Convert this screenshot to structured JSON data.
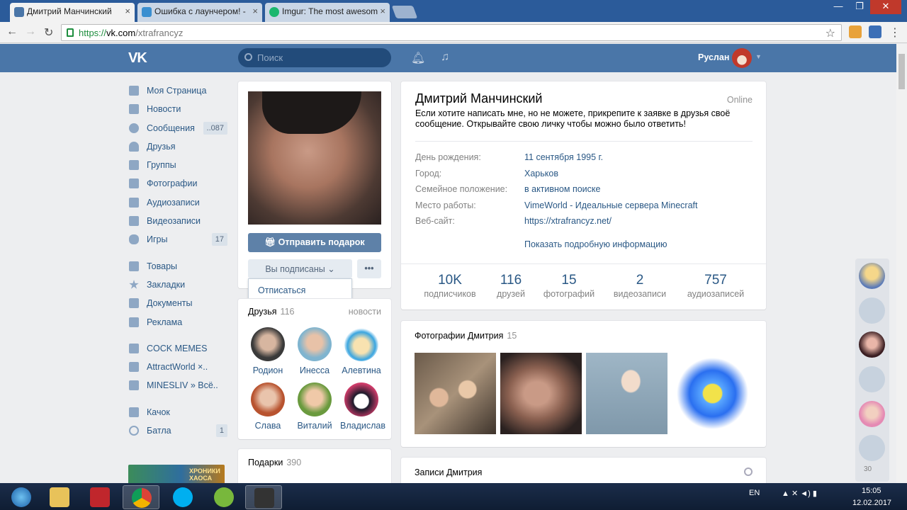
{
  "browser": {
    "tabs": [
      {
        "title": "Дмитрий Манчинский",
        "close": "×"
      },
      {
        "title": "Ошибка с лаунчером! - ",
        "close": "×"
      },
      {
        "title": "Imgur: The most awesom",
        "close": "×"
      }
    ],
    "url_scheme": "https://",
    "url_host": "vk.com",
    "url_path": "/xtrafrancyz",
    "window_controls": {
      "minimize": "—",
      "maximize": "❐",
      "close": "✕"
    }
  },
  "header": {
    "logo": "VK",
    "search_placeholder": "Поиск",
    "user_name": "Руслан"
  },
  "sidebar": {
    "items": [
      {
        "label": "Моя Страница",
        "icon": "home-icon"
      },
      {
        "label": "Новости",
        "icon": "news-icon"
      },
      {
        "label": "Сообщения",
        "icon": "messages-icon",
        "count": "..087"
      },
      {
        "label": "Друзья",
        "icon": "friends-icon"
      },
      {
        "label": "Группы",
        "icon": "groups-icon"
      },
      {
        "label": "Фотографии",
        "icon": "camera-icon"
      },
      {
        "label": "Аудиозаписи",
        "icon": "music-icon"
      },
      {
        "label": "Видеозаписи",
        "icon": "video-icon"
      },
      {
        "label": "Игры",
        "icon": "gamepad-icon",
        "count": "17"
      }
    ],
    "items2": [
      {
        "label": "Товары",
        "icon": "bag-icon"
      },
      {
        "label": "Закладки",
        "icon": "star-icon"
      },
      {
        "label": "Документы",
        "icon": "document-icon"
      },
      {
        "label": "Реклама",
        "icon": "megaphone-icon"
      }
    ],
    "groups": [
      {
        "label": "COCK MEMES"
      },
      {
        "label": "AttractWorld ×.."
      },
      {
        "label": "MINESLIV » Всё.."
      }
    ],
    "apps": [
      {
        "label": "Качок",
        "icon": "apps-icon"
      },
      {
        "label": "Батла",
        "icon": "target-icon",
        "count": "1"
      }
    ],
    "promo_text": "ХРОНИКИ ХАОСА"
  },
  "profile_actions": {
    "gift_button": "Отправить подарок",
    "subscribed_button": "Вы подписаны",
    "more_button": "•••",
    "unsubscribe": "Отписаться"
  },
  "friends_block": {
    "title": "Друзья",
    "count": "116",
    "link": "новости",
    "friends": [
      "Родион",
      "Инесса",
      "Алевтина",
      "Слава",
      "Виталий",
      "Владислав"
    ]
  },
  "gifts_block": {
    "title": "Подарки",
    "count": "390"
  },
  "profile": {
    "name": "Дмитрий Манчинский",
    "online": "Online",
    "status": "Если хотите написать мне, но не можете, прикрепите к заявке в друзья своё сообщение. Открывайте свою личку чтобы можно было ответить!",
    "info": [
      {
        "label": "День рождения:",
        "value": "11 сентября 1995 г."
      },
      {
        "label": "Город:",
        "value": "Харьков"
      },
      {
        "label": "Семейное положение:",
        "value": "в активном поиске"
      },
      {
        "label": "Место работы:",
        "value": "VimeWorld - Идеальные сервера Minecraft"
      },
      {
        "label": "Веб-сайт:",
        "value": "https://xtrafrancyz.net/"
      }
    ],
    "more_info": "Показать подробную информацию",
    "stats": [
      {
        "num": "10K",
        "label": "подписчиков"
      },
      {
        "num": "116",
        "label": "друзей"
      },
      {
        "num": "15",
        "label": "фотографий"
      },
      {
        "num": "2",
        "label": "видеозаписи"
      },
      {
        "num": "757",
        "label": "аудиозаписей"
      }
    ]
  },
  "photos_block": {
    "title": "Фотографии Дмитрия",
    "count": "15"
  },
  "posts_block": {
    "title": "Записи Дмитрия"
  },
  "dock": {
    "count": "30"
  },
  "taskbar": {
    "lang": "EN",
    "time": "15:05",
    "date": "12.02.2017"
  },
  "colors": {
    "vk_blue": "#4a76a8",
    "link": "#2a5885",
    "bg": "#edeef0"
  }
}
